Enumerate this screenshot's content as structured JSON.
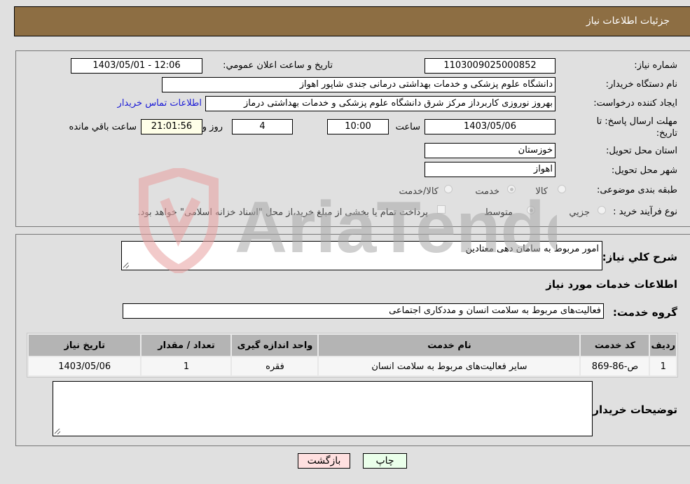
{
  "header": {
    "title": "جزئیات اطلاعات نیاز"
  },
  "form": {
    "need_number": {
      "label": "شماره نیاز:",
      "value": "1103009025000852"
    },
    "announce_datetime": {
      "label": "تاریخ و ساعت اعلان عمومي:",
      "value": "1403/05/01 - 12:06"
    },
    "buyer_org": {
      "label": "نام دستگاه خریدار:",
      "value": "دانشگاه علوم پزشکی و خدمات بهداشتی درمانی جندی شاپور اهواز"
    },
    "requester": {
      "label": "ایجاد کننده درخواست:",
      "value": "بهروز نوروزی کاربرداز مرکز شرق دانشگاه علوم پزشکی و خدمات بهداشتی درماز",
      "contact_link": "اطلاعات تماس خریدار"
    },
    "deadline": {
      "label_line1": "مهلت ارسال پاسخ: تا",
      "label_line2": "تاریخ:",
      "date": "1403/05/06",
      "time_label": "ساعت",
      "time": "10:00",
      "days": "4",
      "days_label": "روز و",
      "remaining": "21:01:56",
      "remaining_label": "ساعت باقي مانده"
    },
    "province": {
      "label": "استان محل تحویل:",
      "value": "خوزستان"
    },
    "city": {
      "label": "شهر محل تحویل:",
      "value": "اهواز"
    },
    "category": {
      "label": "طبقه بندی موضوعی:",
      "options": [
        "کالا",
        "خدمت",
        "کالا/خدمت"
      ],
      "selected": "خدمت"
    },
    "purchase_type": {
      "label": "نوع فرآیند خرید :",
      "options": [
        "جزيي",
        "متوسط"
      ],
      "selected": "متوسط",
      "treasury_note": "پرداخت تمام یا بخشی از مبلغ خرید،از محل \"اسناد خزانه اسلامی\" خواهد بود."
    }
  },
  "details": {
    "description_label": "شرح کلي نیاز:",
    "description_value": "امور مربوط به سامان دهی معتادین",
    "services_heading": "اطلاعات خدمات مورد نیاز",
    "service_group_label": "گروه خدمت:",
    "service_group_value": "فعالیت‌های مربوط به سلامت انسان و مددکاری اجتماعی",
    "table": {
      "headers": [
        "ردیف",
        "کد خدمت",
        "نام خدمت",
        "واحد اندازه گیری",
        "تعداد / مقدار",
        "تاریخ نیاز"
      ],
      "rows": [
        [
          "1",
          "ص-86-869",
          "سایر فعالیت‌های مربوط به سلامت انسان",
          "فقره",
          "1",
          "1403/05/06"
        ]
      ]
    },
    "buyer_notes_label": "توضیحات خریدار:",
    "buyer_notes_value": ""
  },
  "buttons": {
    "print": "چاپ",
    "back": "بازگشت"
  },
  "watermark": {
    "text": "AriaTender.neT"
  },
  "colors": {
    "header_bg": "#8d6e43",
    "link": "#1a1ad6",
    "back_btn": "#ffe0e0",
    "print_btn": "#eaffea"
  }
}
